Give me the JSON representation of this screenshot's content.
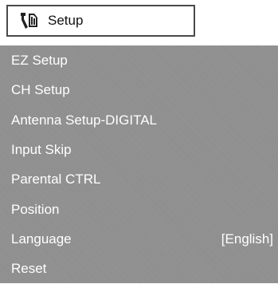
{
  "header": {
    "title": "Setup",
    "icon": "setup-wrench-icon"
  },
  "menu": {
    "items": [
      {
        "label": "EZ Setup",
        "value": ""
      },
      {
        "label": "CH Setup",
        "value": ""
      },
      {
        "label": "Antenna Setup-DIGITAL",
        "value": ""
      },
      {
        "label": "Input Skip",
        "value": ""
      },
      {
        "label": "Parental CTRL",
        "value": ""
      },
      {
        "label": "Position",
        "value": ""
      },
      {
        "label": "Language",
        "value": "[English]"
      },
      {
        "label": "Reset",
        "value": ""
      }
    ]
  },
  "colors": {
    "panel_background": "#8f8f8f",
    "text": "#ffffff",
    "title_border": "#4a4a4a"
  }
}
